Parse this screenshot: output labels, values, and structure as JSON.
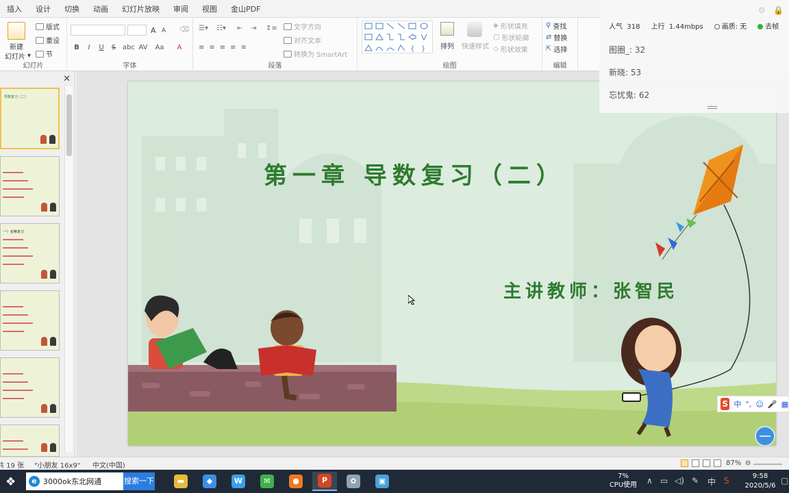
{
  "ribbon_tabs": [
    "插入",
    "设计",
    "切换",
    "动画",
    "幻灯片放映",
    "审阅",
    "视图",
    "金山PDF"
  ],
  "ribbon": {
    "slides": {
      "new_slide": "新建",
      "new_slide2": "幻灯片",
      "layout": "版式",
      "reset": "重设",
      "section": "节",
      "label": "幻灯片"
    },
    "font": {
      "bold": "B",
      "italic": "I",
      "underline": "U",
      "strike": "S",
      "shadow": "abc",
      "spacing": "AV",
      "case": "Aa",
      "grow": "A",
      "shrink": "A",
      "color": "A",
      "label": "字体"
    },
    "paragraph": {
      "text_direction": "文字方向",
      "align_text": "对齐文本",
      "smartart": "转换为 SmartArt",
      "label": "段落"
    },
    "drawing": {
      "arrange": "排列",
      "quick_styles": "快速样式",
      "shape_fill": "形状填充",
      "shape_outline": "形状轮廓",
      "shape_effects": "形状效果",
      "label": "绘图"
    },
    "editing": {
      "find": "查找",
      "replace": "替换",
      "select": "选择",
      "label": "编辑"
    }
  },
  "slide": {
    "title": "第一章   导数复习（二）",
    "subtitle": "主讲教师：张智民"
  },
  "thumbnails": [
    {
      "text": "导数复习（二）"
    },
    {
      "text": ""
    },
    {
      "text": "一）初等复习"
    },
    {
      "text": ""
    },
    {
      "text": ""
    },
    {
      "text": ""
    }
  ],
  "overlay": {
    "popularity_label": "人气",
    "popularity": "318",
    "upload_label": "上行",
    "upload": "1.44mbps",
    "video_label": "画质: 无",
    "mic_label": "去帧",
    "stat1": "图圈_: 32",
    "stat2": "新晓: 53",
    "stat3": "忘忧鬼: 62"
  },
  "ime": {
    "logo": "S",
    "mode": "中",
    "punct": "°,"
  },
  "statusbar": {
    "slide_count": "共 19 张",
    "theme": "\"小朋友 16x9\"",
    "language": "中文(中国)",
    "zoom": "87%"
  },
  "taskbar": {
    "search_value": "3000ok东北网通",
    "search_button": "搜索一下",
    "apps": [
      {
        "name": "file-explorer",
        "glyph": "▬",
        "color": "#e8b93b"
      },
      {
        "name": "feishu",
        "glyph": "◆",
        "color": "#3b8fe6"
      },
      {
        "name": "w-app",
        "glyph": "W",
        "color": "#3aa0e8"
      },
      {
        "name": "wechat",
        "glyph": "✉",
        "color": "#3fb24a"
      },
      {
        "name": "firefox",
        "glyph": "●",
        "color": "#ef7a21"
      },
      {
        "name": "powerpoint",
        "glyph": "P",
        "color": "#d24726"
      },
      {
        "name": "settings",
        "glyph": "✿",
        "color": "#8ea3b8"
      },
      {
        "name": "tool",
        "glyph": "▣",
        "color": "#4aa0d8"
      }
    ],
    "cpu_percent": "7%",
    "cpu_label": "CPU使用",
    "ime_lang": "中",
    "time": "9:58",
    "date": "2020/5/6"
  }
}
